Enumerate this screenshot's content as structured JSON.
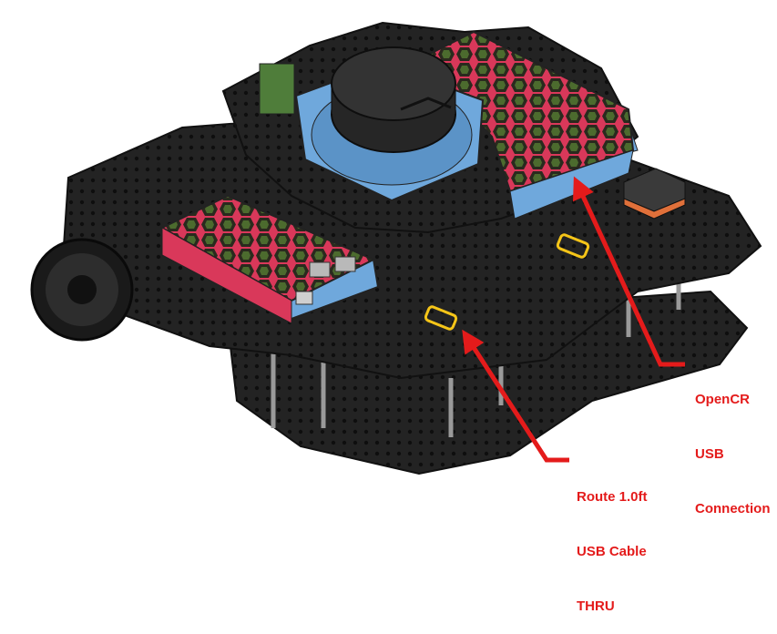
{
  "callouts": {
    "opencr": {
      "lines": [
        "OpenCR",
        "USB",
        "Connection"
      ],
      "color": "#e41b1b"
    },
    "route": {
      "lines": [
        "Route 1.0ft",
        "USB Cable",
        "THRU"
      ],
      "color": "#e41b1b"
    }
  },
  "colors": {
    "chassis": "#1e1e1e",
    "case_pink": "#e0415e",
    "case_blue": "#6fa8dc",
    "highlight": "#f5c518",
    "arrow": "#e41b1b"
  }
}
